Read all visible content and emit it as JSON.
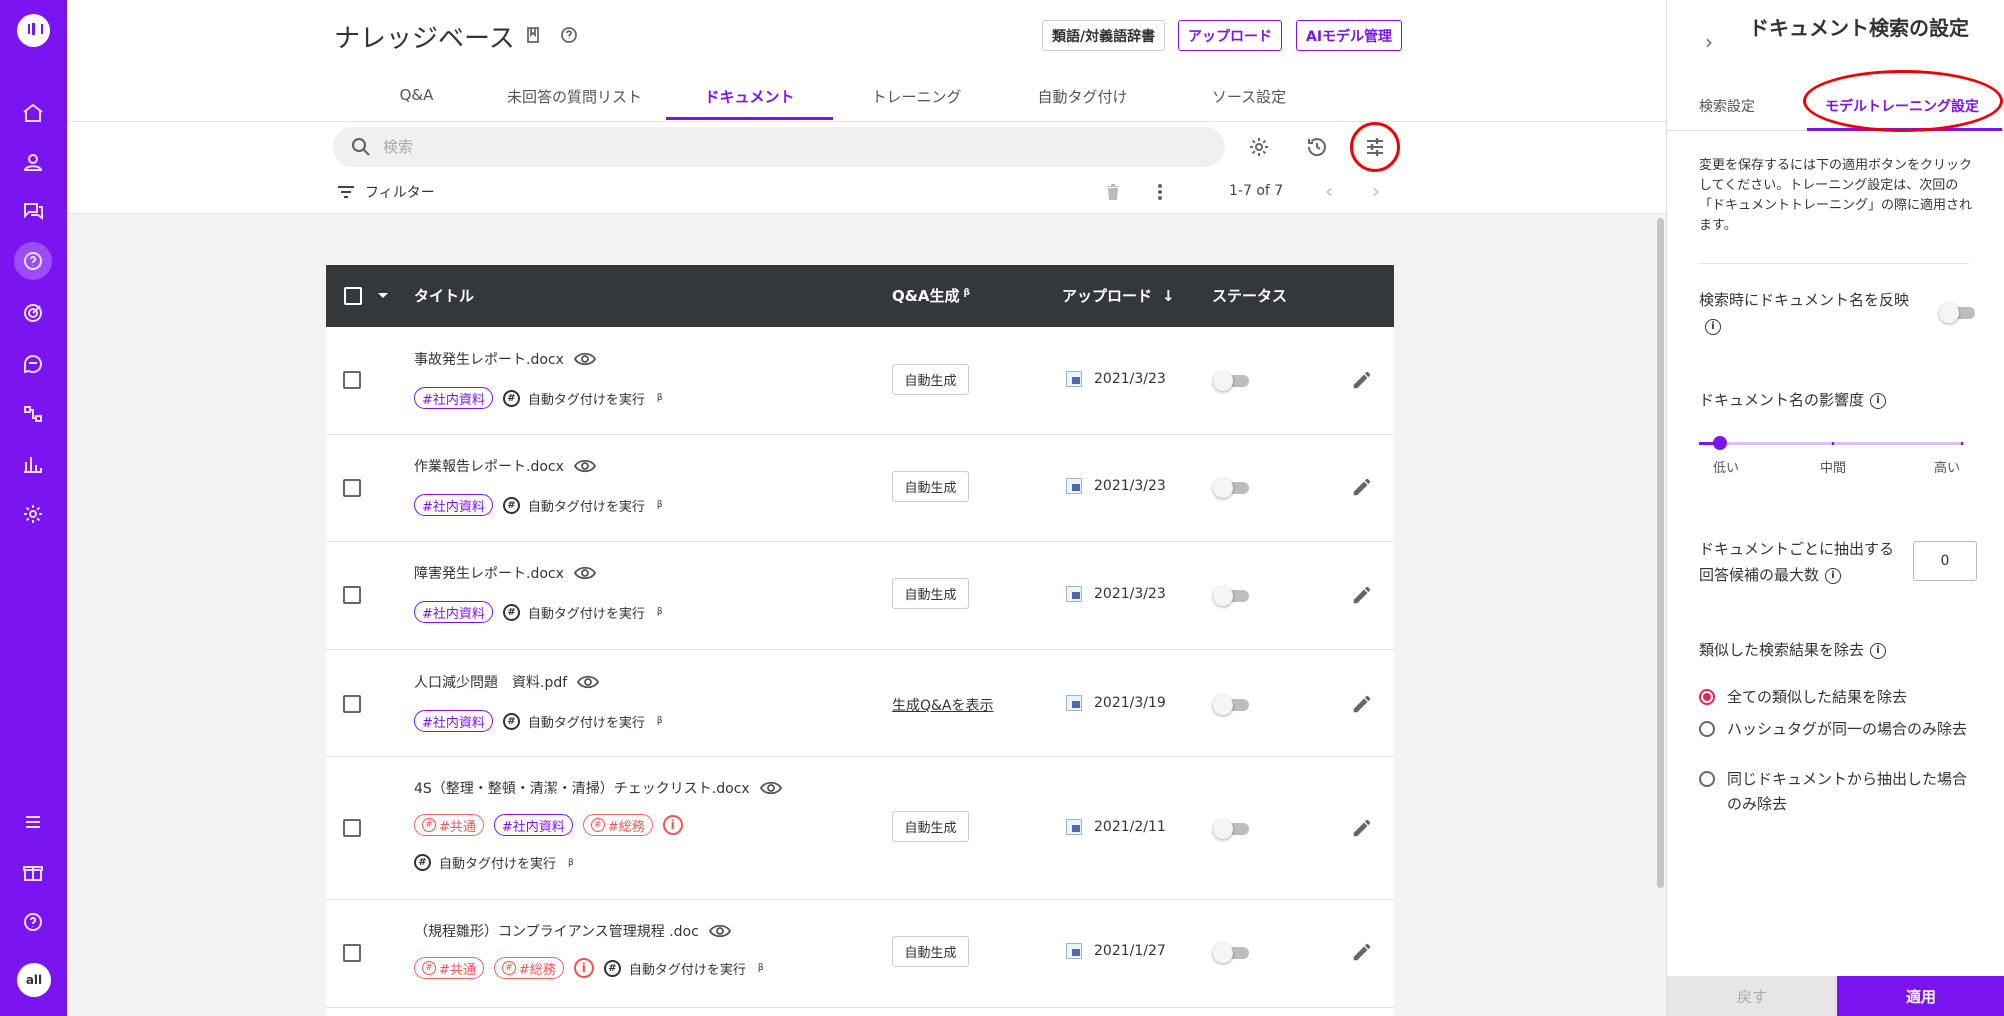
{
  "header": {
    "title": "ナレッジベース",
    "buttons": [
      "類語/対義語辞書",
      "アップロード",
      "AIモデル管理"
    ]
  },
  "tabs": [
    "Q&A",
    "未回答の質問リスト",
    "ドキュメント",
    "トレーニング",
    "自動タグ付け",
    "ソース設定"
  ],
  "active_tab": "ドキュメント",
  "search": {
    "placeholder": "検索"
  },
  "toolbar": {
    "filter_label": "フィルター",
    "pager": "1-7 of 7"
  },
  "user_avatar": "all",
  "table": {
    "columns": {
      "title": "タイトル",
      "qa": "Q&A生成",
      "qa_sup": "β",
      "upload": "アップロード",
      "upload_sort": "↓",
      "status": "ステータス"
    },
    "auto_tag_label": "自動タグ付けを実行",
    "auto_tag_sup": "β",
    "rows": [
      {
        "name": "事故発生レポート.docx",
        "tags": [
          "#社内資料"
        ],
        "qa": "自動生成",
        "date": "2021/3/23"
      },
      {
        "name": "作業報告レポート.docx",
        "tags": [
          "#社内資料"
        ],
        "qa": "自動生成",
        "date": "2021/3/23"
      },
      {
        "name": "障害発生レポート.docx",
        "tags": [
          "#社内資料"
        ],
        "qa": "自動生成",
        "date": "2021/3/23"
      },
      {
        "name": "人口減少問題　資料.pdf",
        "tags": [
          "#社内資料"
        ],
        "qa": "生成Q&Aを表示",
        "date": "2021/3/19"
      },
      {
        "name": "4S（整理・整頓・清潔・清掃）チェックリスト.docx",
        "tags": [
          "#共通",
          "#社内資料",
          "#総務"
        ],
        "qa": "自動生成",
        "date": "2021/2/11"
      },
      {
        "name": "（規程雛形）コンプライアンス管理規程 .doc",
        "tags": [
          "#共通",
          "#総務"
        ],
        "qa": "自動生成",
        "date": "2021/1/27"
      }
    ]
  },
  "panel": {
    "title": "ドキュメント検索の設定",
    "tabs": [
      "検索設定",
      "モデルトレーニング設定"
    ],
    "note": "変更を保存するには下の適用ボタンをクリックしてください。トレーニング設定は、次回の「ドキュメントトレーニング」の際に適用されます。",
    "reflect_name_label": "検索時にドキュメント名を反映",
    "influence_label": "ドキュメント名の影響度",
    "influence_value": 0,
    "influence_levels": [
      "低い",
      "中間",
      "高い"
    ],
    "max_candidates_label": "ドキュメントごとに抽出する回答候補の最大数",
    "max_candidates_value": "0",
    "dedupe_label": "類似した検索結果を除去",
    "dedupe_options": [
      "全ての類似した結果を除去",
      "ハッシュタグが同一の場合のみ除去",
      "同じドキュメントから抽出した場合のみ除去"
    ],
    "dedupe_selected": 0,
    "back_label": "戻す",
    "apply_label": "適用"
  },
  "colors": {
    "brand": "#7a14f0",
    "header_dark": "#34383d",
    "highlight": "#e00000"
  }
}
